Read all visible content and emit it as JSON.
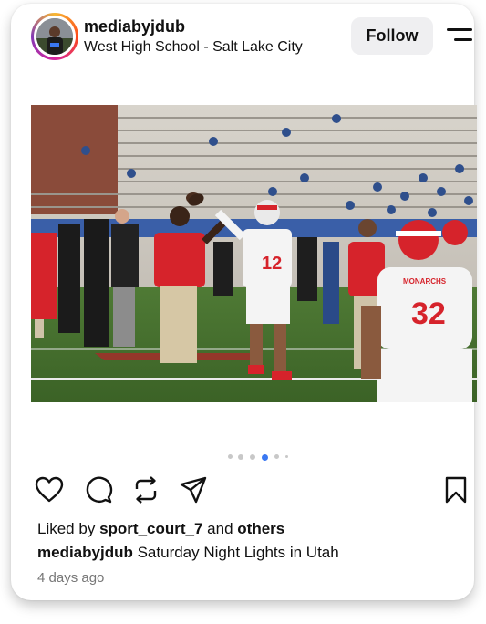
{
  "post": {
    "username": "mediabyjdub",
    "location": "West High School - Salt Lake City",
    "follow_label": "Follow",
    "carousel": {
      "total": 6,
      "active_index": 3
    },
    "photo": {
      "player_number": "12",
      "player_number_back": "32",
      "jersey_text": "MONARCHS"
    },
    "likes": {
      "prefix": "Liked by",
      "user": "sport_court_7",
      "middle": "and",
      "others": "others"
    },
    "caption": {
      "username": "mediabyjdub",
      "text": "Saturday Night Lights in Utah"
    },
    "timestamp": "4 days ago",
    "icons": {
      "like": "heart-icon",
      "comment": "comment-icon",
      "repost": "repost-icon",
      "share": "send-icon",
      "save": "bookmark-icon",
      "menu": "menu-icon"
    },
    "colors": {
      "dot_active": "#3a78f2",
      "dot_inactive": "#c8c8c8",
      "follow_bg": "#efeff1",
      "jersey_red": "#d6232b"
    }
  }
}
